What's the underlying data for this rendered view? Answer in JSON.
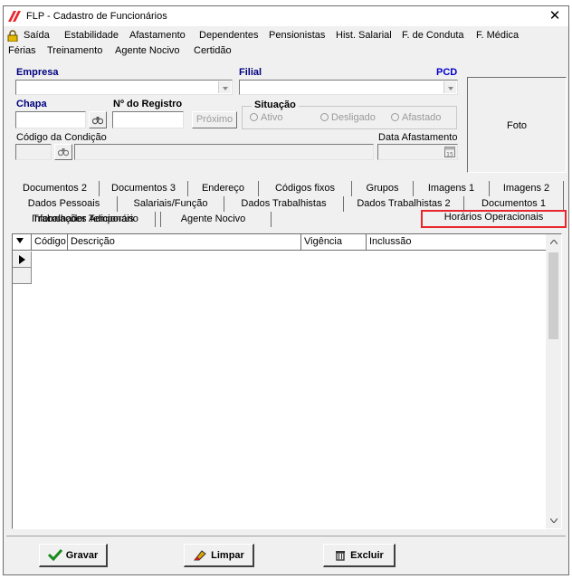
{
  "window": {
    "title": "FLP - Cadastro de Funcionários",
    "close_glyph": "✕"
  },
  "menu": {
    "row1": [
      "Saída",
      "Estabilidade",
      "Afastamento",
      "Dependentes",
      "Pensionistas",
      "Hist. Salarial",
      "F. de Conduta",
      "F. Médica"
    ],
    "row2": [
      "Férias",
      "Treinamento",
      "Agente Nocivo",
      "Certidão"
    ]
  },
  "form": {
    "empresa_label": "Empresa",
    "filial_label": "Filial",
    "pcd_label": "PCD",
    "chapa_label": "Chapa",
    "registro_label": "Nº do Registro",
    "proximo_label": "Próximo",
    "situacao_label": "Situação",
    "radio_ativo": "Ativo",
    "radio_desligado": "Desligado",
    "radio_afastado": "Afastado",
    "codigo_condicao_label": "Código da Condição",
    "data_afastamento_label": "Data Afastamento",
    "foto_label": "Foto"
  },
  "tabs": {
    "row1": [
      "Documentos 2",
      "Documentos 3",
      "Endereço",
      "Códigos fixos",
      "Grupos",
      "Imagens 1",
      "Imagens 2"
    ],
    "row2": [
      "Dados Pessoais",
      "Salariais/Função",
      "Dados Trabalhistas",
      "Dados Trabalhistas 2",
      "Documentos 1"
    ],
    "row3": [
      "Informações Adicionais",
      "Agente Nocivo",
      "Trabalhador Temporário",
      "Horários Operacionais"
    ],
    "active": "Horários Operacionais"
  },
  "grid": {
    "columns": [
      "Código",
      "Descrição",
      "Vigência",
      "Inclussão"
    ]
  },
  "actions": {
    "gravar": "Gravar",
    "limpar": "Limpar",
    "excluir": "Excluir"
  },
  "colors": {
    "accent_red": "#e8262b",
    "label_blue": "#000080",
    "window_bg": "#f0f0f0"
  }
}
